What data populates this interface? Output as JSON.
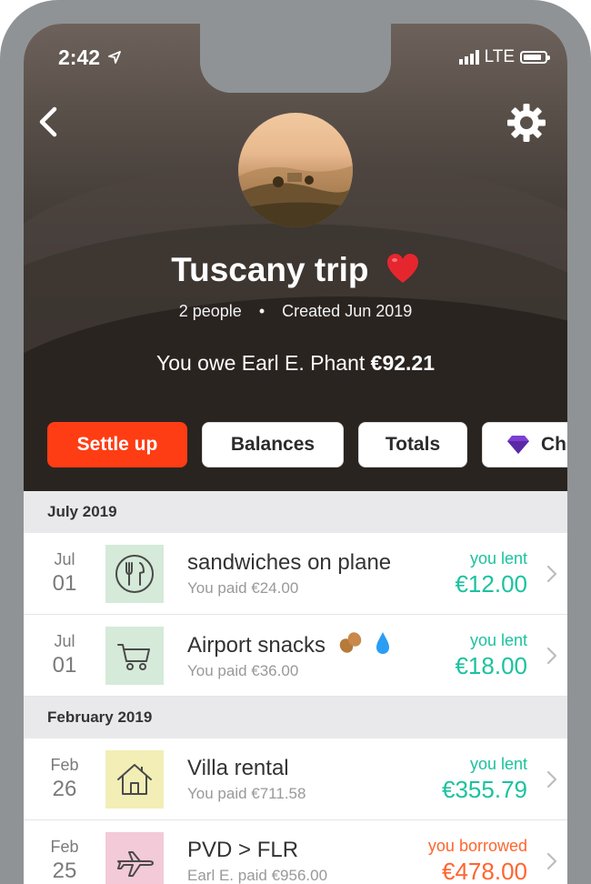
{
  "status": {
    "time": "2:42",
    "network": "LTE"
  },
  "colors": {
    "accent": "#ff3d14",
    "lent": "#1cc29f",
    "borrowed": "#ff652f"
  },
  "group": {
    "name": "Tuscany trip",
    "people": "2 people",
    "separator": "•",
    "created": "Created Jun 2019",
    "owe_text": "You owe Earl E. Phant",
    "owe_amount": "€92.21"
  },
  "actions": {
    "settle": "Settle up",
    "balances": "Balances",
    "totals": "Totals",
    "charts": "Ch"
  },
  "sections": [
    {
      "label": "July 2019",
      "items": [
        {
          "month": "Jul",
          "day": "01",
          "title": "sandwiches on plane",
          "sub": "You paid €24.00",
          "status": "you lent",
          "amount": "€12.00",
          "icon": "fork-knife-icon"
        },
        {
          "month": "Jul",
          "day": "01",
          "title": "Airport snacks",
          "sub": "You paid €36.00",
          "status": "you lent",
          "amount": "€18.00",
          "icon": "cart-icon"
        }
      ]
    },
    {
      "label": "February 2019",
      "items": [
        {
          "month": "Feb",
          "day": "26",
          "title": "Villa rental",
          "sub": "You paid €711.58",
          "status": "you lent",
          "amount": "€355.79",
          "icon": "house-icon"
        },
        {
          "month": "Feb",
          "day": "25",
          "title": "PVD > FLR",
          "sub": "Earl E. paid €956.00",
          "status": "you borrowed",
          "amount": "€478.00",
          "icon": "airplane-icon"
        }
      ]
    }
  ]
}
